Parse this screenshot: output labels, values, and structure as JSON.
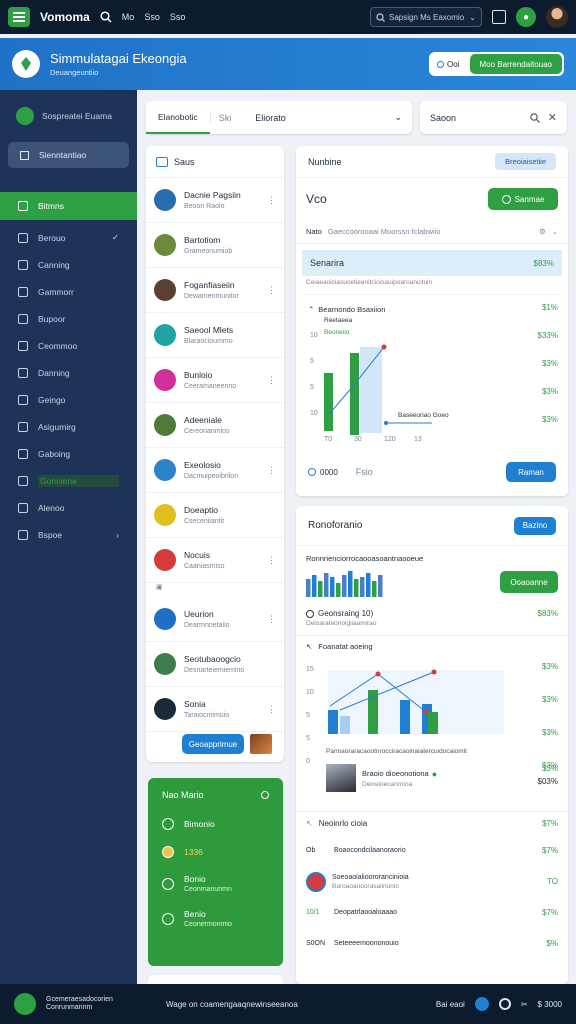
{
  "topbar": {
    "brand": "Vomoma",
    "nav": [
      "Mo",
      "Sso",
      "Sso"
    ],
    "search_placeholder": "Sapsign Ms Eaxomio"
  },
  "header": {
    "title": "Simmulatagai Ekeongia",
    "subtitle": "Deuangeuntiio",
    "toggle_label": "Ooi",
    "action_label": "Moo Barrendaitouao"
  },
  "sidebar": {
    "top_item": "Sospreatei Euama",
    "search_item": "Sienntantiao",
    "items": [
      {
        "label": "Bitmns",
        "icon": "refresh-icon",
        "active": true
      },
      {
        "label": "Berouo",
        "icon": "grid-icon",
        "check": "✓"
      },
      {
        "label": "Canning",
        "icon": "folder-icon"
      },
      {
        "label": "Gammorr",
        "icon": "chat-icon"
      },
      {
        "label": "Bupoor",
        "icon": "briefcase-icon"
      },
      {
        "label": "Ceommoo",
        "icon": "calendar-icon"
      },
      {
        "label": "Danning",
        "icon": "window-icon"
      },
      {
        "label": "Geingo",
        "icon": "phone-icon"
      },
      {
        "label": "Asigumirg",
        "icon": "document-icon"
      },
      {
        "label": "Gaboing",
        "icon": "trash-icon"
      },
      {
        "label": "Gonniene",
        "icon": "message-icon",
        "highlight": true
      },
      {
        "label": "Alenoo",
        "icon": "rocket-icon"
      },
      {
        "label": "Bspoe",
        "icon": "info-icon",
        "chevron": "›"
      }
    ]
  },
  "tabs": {
    "active": "Elanobotic",
    "second": "Ski",
    "dropdown": "Eliorato",
    "search_value": "Saoon"
  },
  "contacts": {
    "header": "Saus",
    "items": [
      {
        "name": "Dacnie Pagsiin",
        "sub": "Beoon Raolo",
        "color": "#2a6cb0"
      },
      {
        "name": "Bartotiom",
        "sub": "Grameonumiob",
        "color": "#6c8a3c"
      },
      {
        "name": "Foganfiaseiin",
        "sub": "Dewamenmunitor",
        "color": "#5a4030"
      },
      {
        "name": "Saeool Mlets",
        "sub": "Blaraocioummo",
        "color": "#1fa3a3"
      },
      {
        "name": "Bunloio",
        "sub": "Ceeramaneenno",
        "color": "#d0309a"
      },
      {
        "name": "Adeeniale",
        "sub": "Cereonanmios",
        "color": "#4f7a3a"
      },
      {
        "name": "Exeolosio",
        "sub": "Dacmuipeoibrilon",
        "color": "#2b83c8"
      },
      {
        "name": "Doeaptio",
        "sub": "Cseceniiantit",
        "color": "#e0c020"
      },
      {
        "name": "Nocuis",
        "sub": "Caaniasmiso",
        "color": "#d63b3b"
      }
    ],
    "small_label": "",
    "items2": [
      {
        "name": "Ueurion",
        "sub": "Dearmnnetaiio",
        "color": "#1f6fc4"
      },
      {
        "name": "Seotubaoogcio",
        "sub": "Desnarteiemiemlno",
        "color": "#3f7d4c"
      },
      {
        "name": "Sonia",
        "sub": "Taraiocmimuio",
        "color": "#1a2a3a"
      }
    ],
    "footer_button": "Geoapprimue"
  },
  "green_card": {
    "title": "Nao Mario",
    "items": [
      {
        "label": "Bimonio",
        "icon": "chat-icon"
      },
      {
        "label": "1336",
        "icon": "coin-icon"
      },
      {
        "label": "Bonio",
        "sub": "Ceonmanunmn",
        "icon": "shield-icon"
      },
      {
        "label": "Benio",
        "sub": "Ceonermonmio",
        "icon": "globe-icon"
      }
    ]
  },
  "panel1": {
    "tag": "Nunbine",
    "badge": "Breoiaisetiie",
    "title": "Vco",
    "action": "Sanmae",
    "filter_label": "Nato",
    "filter_value": "Gaeccoorooaai Moorssn fclabwiio",
    "band_label": "Senarira",
    "band_pct": "$83%",
    "band_sub": "Ceiaeaoiciasuoetieanitcioisauipoaroancituin",
    "chart_title": "Bearnondo Bsaxiion",
    "chart_legend": [
      "Reetaeea",
      "Beoneiio"
    ],
    "chart_callout": "Baseeoriao Goeo",
    "pcts": [
      "$1%",
      "$33%",
      "$3%",
      "$3%",
      "$3%"
    ],
    "y_ticks": [
      "10",
      "5",
      "5",
      "10"
    ],
    "x_ticks": [
      "T0",
      "30",
      "120",
      "13"
    ],
    "foot_left": "0000",
    "foot_right": "Fsio",
    "foot_button": "Raman"
  },
  "panel2": {
    "title": "Ronoforanio",
    "button": "Bazino",
    "sub": "Ronnrienciorrocaooasoantnaooeue",
    "green_button": "Ooaoanne",
    "row_label": "Geonsraing 10)",
    "row_sub": "Deioarateonoigiiaamirao",
    "row_pct": "$83%",
    "chart_title": "Foanatat aoeing",
    "chart_note": "Pannaoraracaootnrocciracaoinaiatercuidocaiomit",
    "chart_pcts": [
      "$3%",
      "$3%",
      "$3%",
      "$3%"
    ],
    "y_ticks": [
      "15",
      "10",
      "5",
      "5",
      "0"
    ],
    "person_name": "Braoio dioeonotiona",
    "person_sub": "Deiceioecanrnioa",
    "person_pcts": [
      "$3%",
      "$03%"
    ],
    "list_title": "Neoinrlo cioia",
    "list_pct": "$7%",
    "list": [
      {
        "prefix": "Ob",
        "label": "Boaocondcilaanoraorio",
        "pct": "$7%"
      },
      {
        "prefix": "",
        "label": "Soeoaoialioororancinioia",
        "sub": "Baroaoanoorasaiinonio",
        "pct": "TO"
      },
      {
        "prefix": "10/1",
        "label": "Deopatrlaooaloaaao",
        "pct": "$7%"
      },
      {
        "prefix": "S0ON",
        "label": "Seteeeemoononouio",
        "pct": "$%"
      }
    ]
  },
  "bottombar": {
    "left_label": "Gcemeraesadocorien Conrunmannm",
    "center_label": "Wage on coamengaaqnewinseeanoa",
    "right_label": "Bai eaoi",
    "right_num": "$ 3000"
  },
  "colors": {
    "accent": "#2ea043",
    "blue": "#1f7fd1",
    "navy": "#1d3358"
  }
}
